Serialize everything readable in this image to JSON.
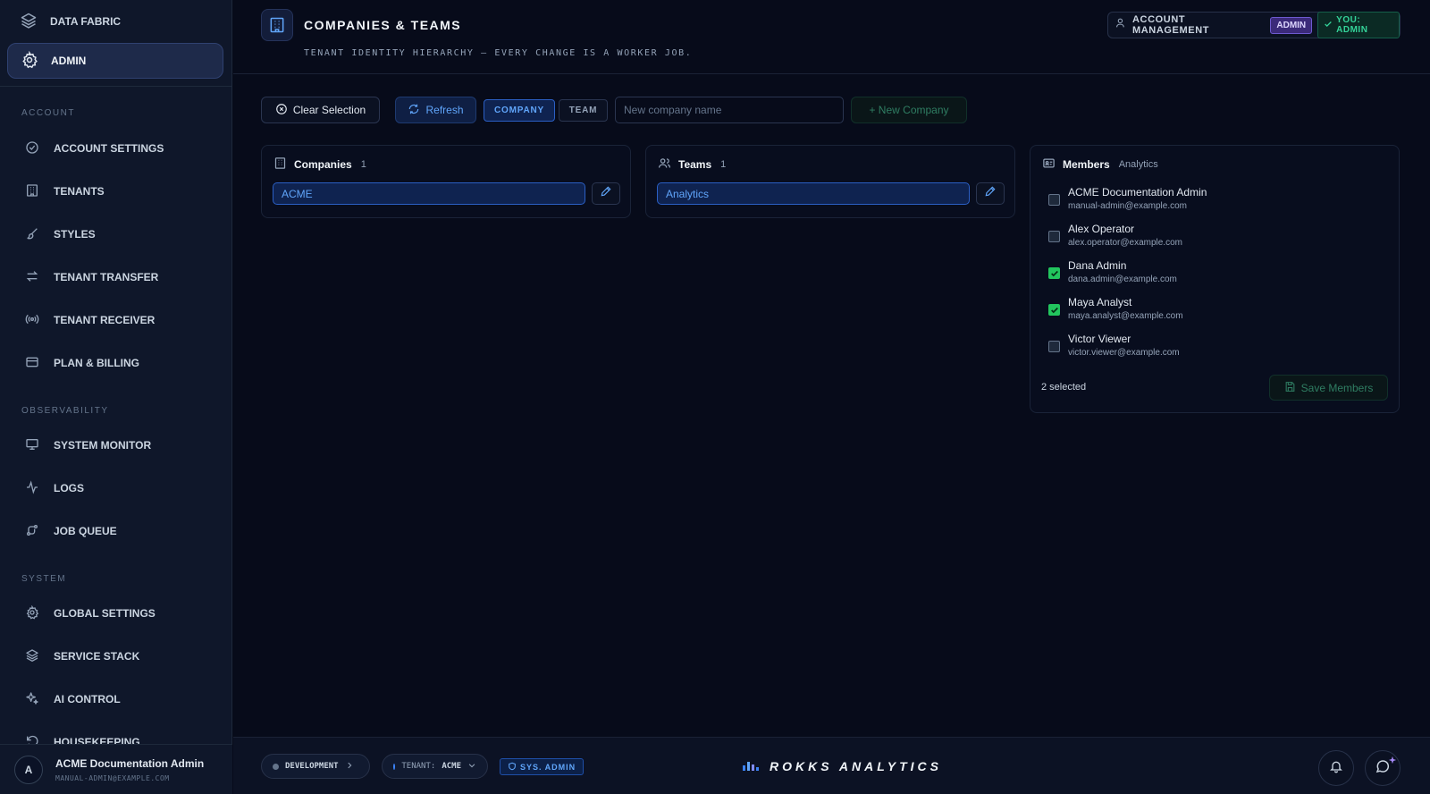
{
  "sidebar": {
    "brand": "DATA FABRIC",
    "active_item": "ADMIN",
    "sections": [
      {
        "label": "ACCOUNT",
        "items": [
          {
            "label": "ACCOUNT SETTINGS",
            "icon": "check-circle-icon"
          },
          {
            "label": "TENANTS",
            "icon": "building-icon"
          },
          {
            "label": "STYLES",
            "icon": "brush-icon"
          },
          {
            "label": "TENANT TRANSFER",
            "icon": "arrows-swap-icon"
          },
          {
            "label": "TENANT RECEIVER",
            "icon": "broadcast-icon"
          },
          {
            "label": "PLAN & BILLING",
            "icon": "credit-card-icon"
          }
        ]
      },
      {
        "label": "OBSERVABILITY",
        "items": [
          {
            "label": "SYSTEM MONITOR",
            "icon": "monitor-icon"
          },
          {
            "label": "LOGS",
            "icon": "activity-icon"
          },
          {
            "label": "JOB QUEUE",
            "icon": "workflow-icon"
          }
        ]
      },
      {
        "label": "SYSTEM",
        "items": [
          {
            "label": "GLOBAL SETTINGS",
            "icon": "gear-icon"
          },
          {
            "label": "SERVICE STACK",
            "icon": "layers-icon"
          },
          {
            "label": "AI CONTROL",
            "icon": "sparkles-icon"
          },
          {
            "label": "HOUSEKEEPING",
            "icon": "rotate-icon"
          }
        ]
      }
    ],
    "user": {
      "initial": "A",
      "name": "ACME Documentation Admin",
      "email": "MANUAL-ADMIN@EXAMPLE.COM"
    }
  },
  "header": {
    "title": "COMPANIES & TEAMS",
    "subtitle": "TENANT IDENTITY HIERARCHY — EVERY CHANGE IS A WORKER JOB.",
    "account_label": "ACCOUNT MANAGEMENT",
    "role_badge": "ADMIN",
    "you_badge": "YOU: ADMIN"
  },
  "toolbar": {
    "clear_label": "Clear Selection",
    "refresh_label": "Refresh",
    "toggle_company": "COMPANY",
    "toggle_team": "TEAM",
    "active_toggle": "COMPANY",
    "input_placeholder": "New company name",
    "input_value": "",
    "new_label": "+ New Company"
  },
  "companies": {
    "title": "Companies",
    "count": "1",
    "items": [
      "ACME"
    ]
  },
  "teams": {
    "title": "Teams",
    "count": "1",
    "items": [
      "Analytics"
    ]
  },
  "members": {
    "title": "Members",
    "context": "Analytics",
    "list": [
      {
        "name": "ACME Documentation Admin",
        "email": "manual-admin@example.com",
        "checked": false
      },
      {
        "name": "Alex Operator",
        "email": "alex.operator@example.com",
        "checked": false
      },
      {
        "name": "Dana Admin",
        "email": "dana.admin@example.com",
        "checked": true
      },
      {
        "name": "Maya Analyst",
        "email": "maya.analyst@example.com",
        "checked": true
      },
      {
        "name": "Victor Viewer",
        "email": "victor.viewer@example.com",
        "checked": false
      }
    ],
    "selected_text": "2 selected",
    "save_label": "Save Members"
  },
  "bottombar": {
    "env": "DEVELOPMENT",
    "tenant_label": "TENANT:",
    "tenant_value": "ACME",
    "role": "SYS. ADMIN",
    "brand": "ROKKS ANALYTICS"
  },
  "colors": {
    "accent": "#60a5fa",
    "success": "#22c55e",
    "admin_badge": "#3b2a7a",
    "background": "#070b1a"
  }
}
